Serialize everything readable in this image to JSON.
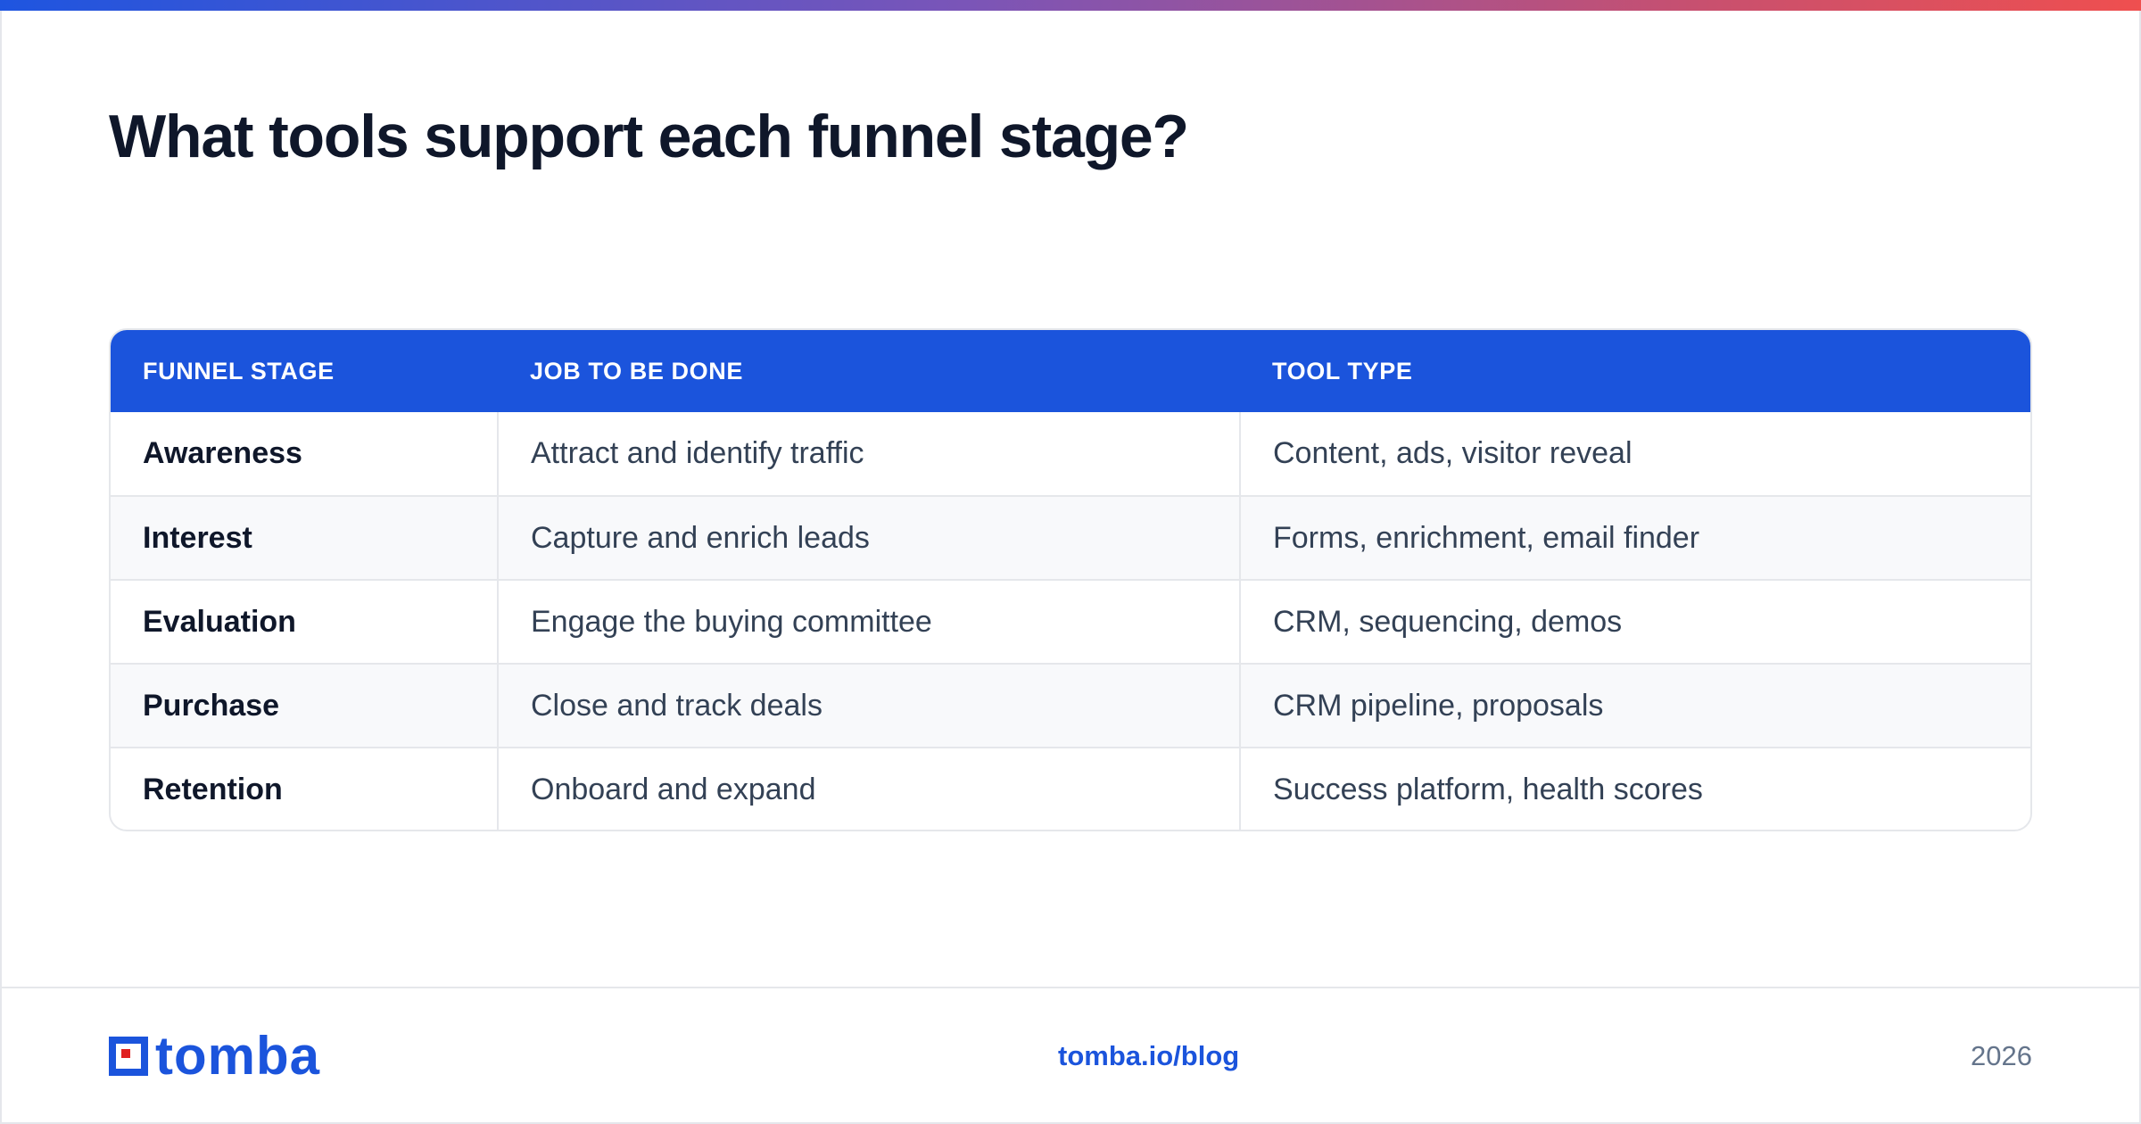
{
  "title": "What tools support each funnel stage?",
  "table": {
    "headers": [
      "FUNNEL STAGE",
      "JOB TO BE DONE",
      "TOOL TYPE"
    ],
    "rows": [
      {
        "stage": "Awareness",
        "job": "Attract and identify traffic",
        "tool": "Content, ads, visitor reveal"
      },
      {
        "stage": "Interest",
        "job": "Capture and enrich leads",
        "tool": "Forms, enrichment, email finder"
      },
      {
        "stage": "Evaluation",
        "job": "Engage the buying committee",
        "tool": "CRM, sequencing, demos"
      },
      {
        "stage": "Purchase",
        "job": "Close and track deals",
        "tool": "CRM pipeline, proposals"
      },
      {
        "stage": "Retention",
        "job": "Onboard and expand",
        "tool": "Success platform, health scores"
      }
    ]
  },
  "footer": {
    "logo_text": "tomba",
    "logo_icon": "tomba-logo-icon",
    "link": "tomba.io/blog",
    "year": "2026"
  },
  "colors": {
    "brand_blue": "#1b54dc",
    "logo_red": "#e02020",
    "title": "#0f172a",
    "body_text": "#334155"
  }
}
